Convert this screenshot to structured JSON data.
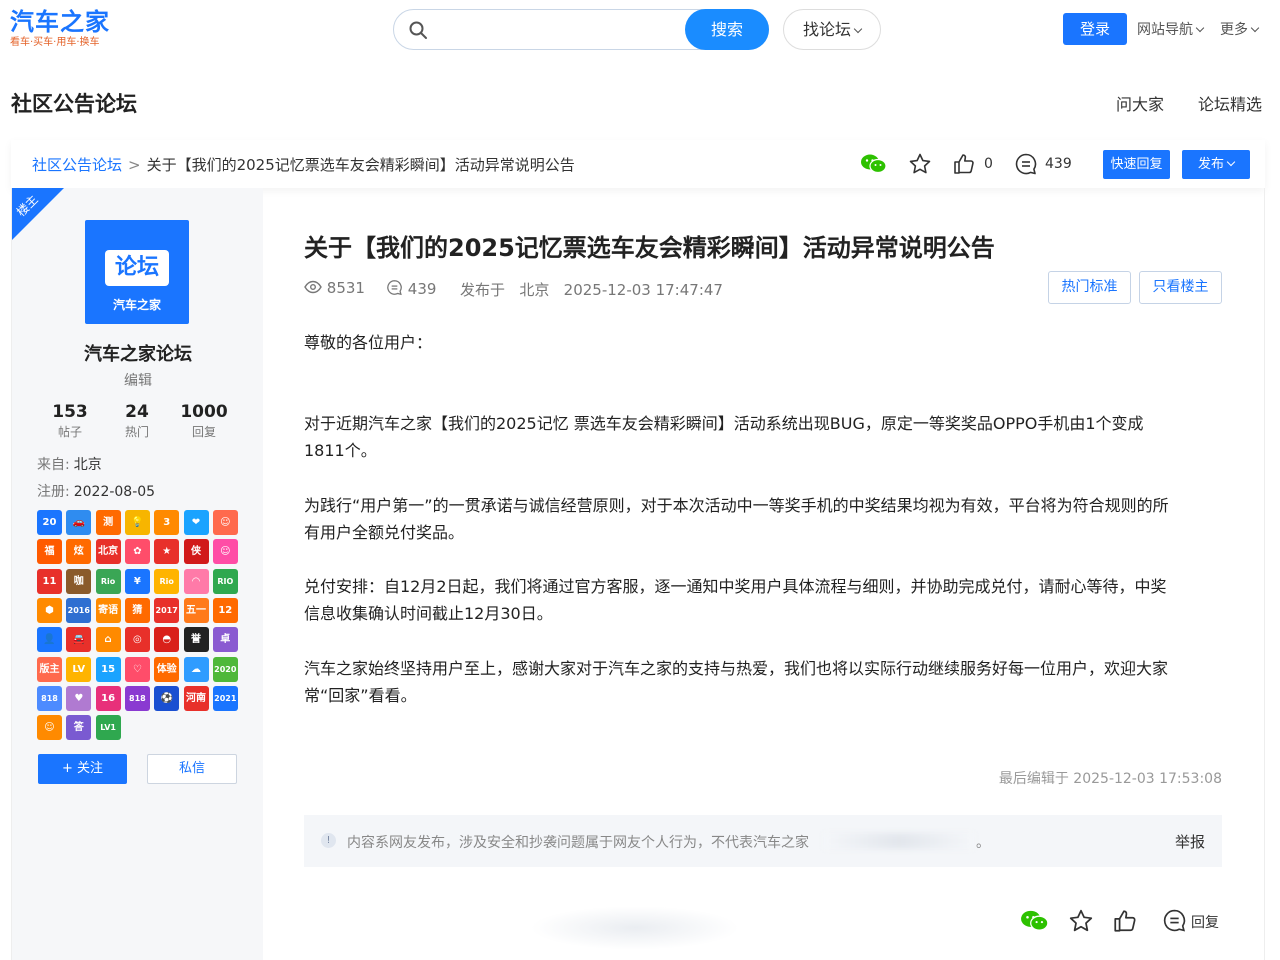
{
  "header": {
    "logo_main": "汽车之家",
    "logo_sub": "看车·买车·用车·换车",
    "search_placeholder": "",
    "search_btn": "搜索",
    "forum_btn": "找论坛",
    "login": "登录",
    "site_nav": "网站导航",
    "more": "更多"
  },
  "sub_header": {
    "title": "社区公告论坛",
    "links": [
      "问大家",
      "论坛精选"
    ]
  },
  "breadcrumb": {
    "root": "社区公告论坛",
    "sep": ">",
    "current": "关于【我们的2025记忆票选车友会精彩瞬间】活动异常说明公告"
  },
  "toolbar": {
    "like_count": "0",
    "reply_count": "439",
    "quick_reply": "快速回复",
    "publish": "发布"
  },
  "author": {
    "badge": "楼主",
    "avatar_text": "论坛",
    "avatar_brand": "汽车之家",
    "name": "汽车之家论坛",
    "role": "编辑",
    "stats": [
      {
        "value": "153",
        "label": "帖子"
      },
      {
        "value": "24",
        "label": "热门"
      },
      {
        "value": "1000",
        "label": "回复"
      }
    ],
    "from_label": "来自:",
    "from_value": "北京",
    "reg_label": "注册:",
    "reg_value": "2022-08-05",
    "follow": "+ 关注",
    "message": "私信",
    "badges": [
      {
        "t": "20",
        "c": "#1a75ff"
      },
      {
        "t": "🚗",
        "c": "#2f8cf0"
      },
      {
        "t": "测",
        "c": "#ff6a00"
      },
      {
        "t": "💡",
        "c": "#f7b500"
      },
      {
        "t": "3",
        "c": "#ff8a00"
      },
      {
        "t": "❤",
        "c": "#1aa3ff"
      },
      {
        "t": "☺",
        "c": "#ff6a4d"
      },
      {
        "t": "福",
        "c": "#ff5a00"
      },
      {
        "t": "炫",
        "c": "#ff6a00"
      },
      {
        "t": "北京",
        "c": "#e8302a"
      },
      {
        "t": "✿",
        "c": "#ff4d6a"
      },
      {
        "t": "★",
        "c": "#e8302a"
      },
      {
        "t": "侠",
        "c": "#d11a1a"
      },
      {
        "t": "☺",
        "c": "#ff4da6"
      },
      {
        "t": "11",
        "c": "#e8302a"
      },
      {
        "t": "咖",
        "c": "#8a5a2b"
      },
      {
        "t": "Rio",
        "c": "#3aa655"
      },
      {
        "t": "¥",
        "c": "#1a75ff"
      },
      {
        "t": "Rio",
        "c": "#ffb400"
      },
      {
        "t": "◠",
        "c": "#ff7aa8"
      },
      {
        "t": "RIO",
        "c": "#2fa84f"
      },
      {
        "t": "⬢",
        "c": "#ff8a00"
      },
      {
        "t": "2016",
        "c": "#2f6fd1"
      },
      {
        "t": "寄语",
        "c": "#ff8a00"
      },
      {
        "t": "猜",
        "c": "#ff6a00"
      },
      {
        "t": "2017",
        "c": "#e8302a"
      },
      {
        "t": "五一",
        "c": "#ff7a1a"
      },
      {
        "t": "12",
        "c": "#ff6a00"
      },
      {
        "t": "👤",
        "c": "#1a75ff"
      },
      {
        "t": "🚘",
        "c": "#e8302a"
      },
      {
        "t": "⌂",
        "c": "#ff8a00"
      },
      {
        "t": "◎",
        "c": "#e8302a"
      },
      {
        "t": "◓",
        "c": "#d9201a"
      },
      {
        "t": "誉",
        "c": "#222222"
      },
      {
        "t": "卓",
        "c": "#8a5ad1"
      },
      {
        "t": "版主",
        "c": "#ff6a4d"
      },
      {
        "t": "LV",
        "c": "#ffb400"
      },
      {
        "t": "15",
        "c": "#1aa3ff"
      },
      {
        "t": "♡",
        "c": "#ff4d6a"
      },
      {
        "t": "体验",
        "c": "#ff6a00"
      },
      {
        "t": "☁",
        "c": "#2f9cff"
      },
      {
        "t": "2020",
        "c": "#4fb83a"
      },
      {
        "t": "818",
        "c": "#4d8bff"
      },
      {
        "t": "♥",
        "c": "#b07ad1"
      },
      {
        "t": "16",
        "c": "#e8307a"
      },
      {
        "t": "818",
        "c": "#8a3ad1"
      },
      {
        "t": "⚽",
        "c": "#1a4fd1"
      },
      {
        "t": "河南",
        "c": "#e8302a"
      },
      {
        "t": "2021",
        "c": "#1a75ff"
      },
      {
        "t": "☺",
        "c": "#ff8a00"
      },
      {
        "t": "答",
        "c": "#7a5ad1"
      },
      {
        "t": "LV1",
        "c": "#2fa84f"
      }
    ]
  },
  "post": {
    "title": "关于【我们的2025记忆票选车友会精彩瞬间】活动异常说明公告",
    "views": "8531",
    "replies": "439",
    "published_label": "发布于",
    "location": "北京",
    "datetime": "2025-12-03 17:47:47",
    "tag_hot": "热门标准",
    "tag_owner": "只看楼主",
    "paragraphs": [
      "尊敬的各位用户：",
      "对于近期汽车之家【我们的2025记忆 票选车友会精彩瞬间】活动系统出现BUG，原定一等奖奖品OPPO手机由1个变成1811个。",
      "为践行“用户第一”的一贯承诺与诚信经营原则，对于本次活动中一等奖手机的中奖结果均视为有效，平台将为符合规则的所有用户全额兑付奖品。",
      "兑付安排：自12月2日起，我们将通过官方客服，逐一通知中奖用户具体流程与细则，并协助完成兑付，请耐心等待，中奖信息收集确认时间截止12月30日。",
      "汽车之家始终坚持用户至上，感谢大家对于汽车之家的支持与热爱，我们也将以实际行动继续服务好每一位用户，欢迎大家常“回家”看看。"
    ],
    "last_edit": "最后编辑于 2025-12-03 17:53:08",
    "notice": "内容系网友发布，涉及安全和抄袭问题属于网友个人行为，不代表汽车之家",
    "notice_end": "。",
    "report": "举报",
    "reply_label": "回复"
  }
}
